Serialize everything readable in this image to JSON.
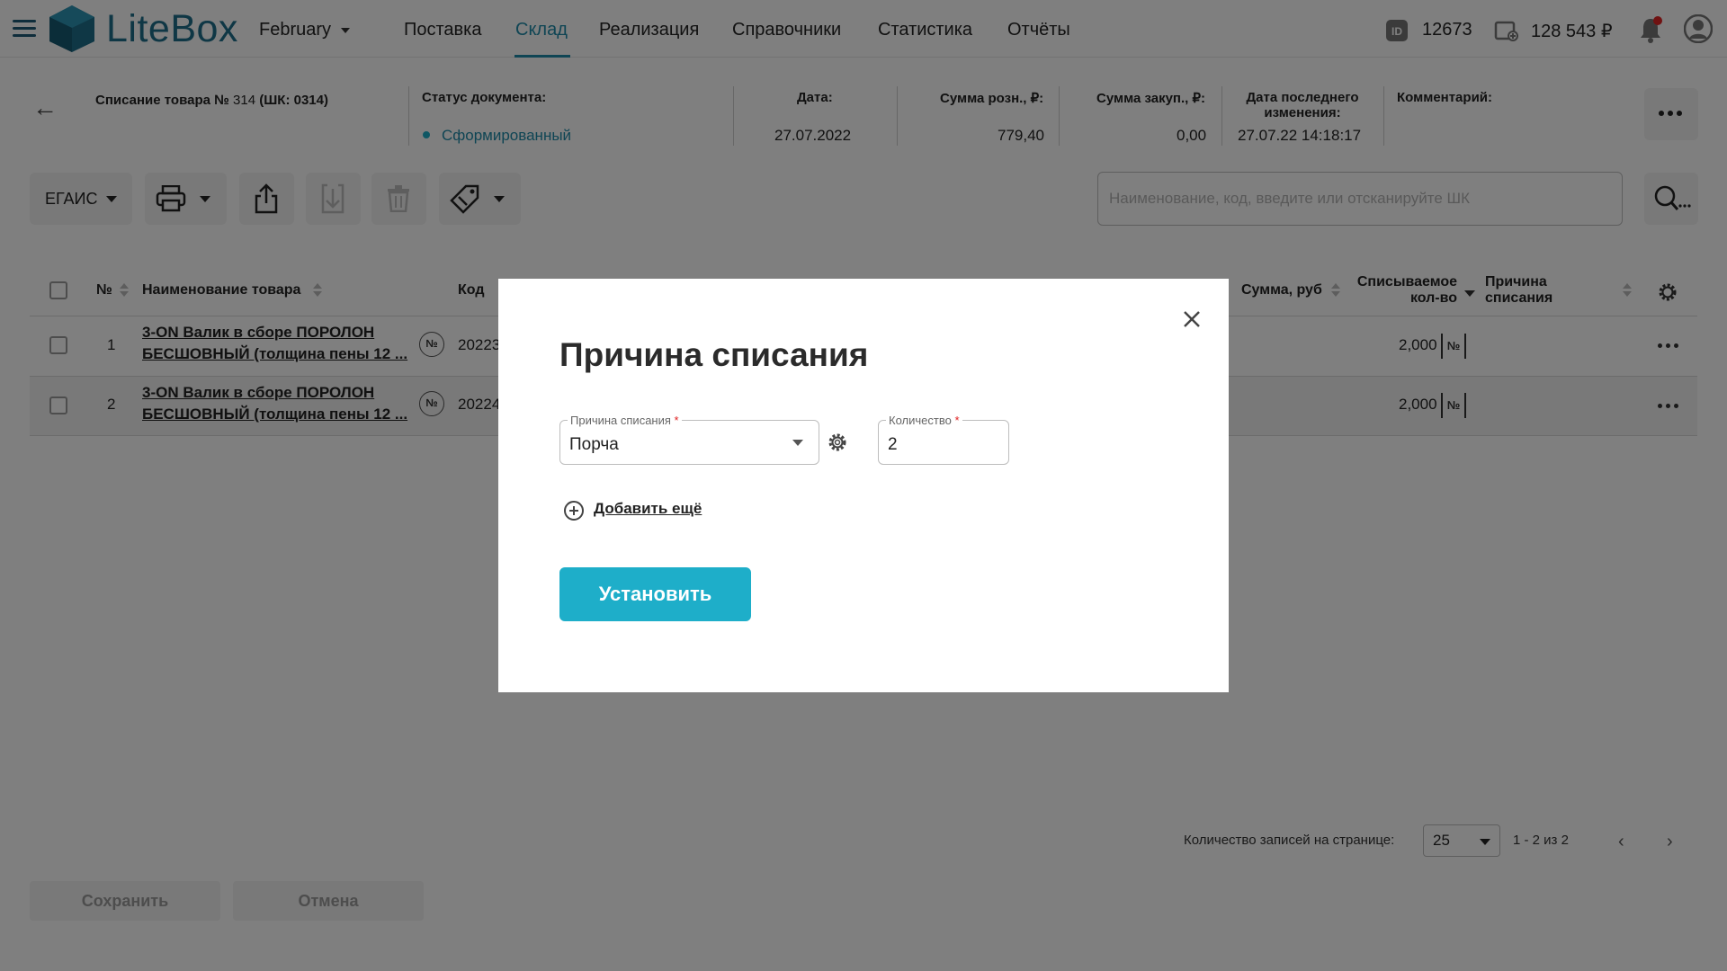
{
  "app": {
    "logo_text": "LiteBox",
    "store": "February",
    "id_value": "12673",
    "balance": "128 543 ₽"
  },
  "nav": [
    "Поставка",
    "Склад",
    "Реализация",
    "Справочники",
    "Статистика",
    "Отчёты"
  ],
  "nav_active": "Склад",
  "document": {
    "title_prefix": "Списание товара №",
    "title_num": "314",
    "title_suffix": "(ШК: 0314)",
    "status_label": "Статус документа:",
    "status_value": "Сформированный",
    "date_label": "Дата:",
    "date_value": "27.07.2022",
    "retail_label": "Сумма розн., ₽:",
    "retail_value": "779,40",
    "purchase_label": "Сумма закуп., ₽:",
    "purchase_value": "0,00",
    "changed_label_1": "Дата последнего",
    "changed_label_2": "изменения:",
    "changed_value": "27.07.22 14:18:17",
    "comment_label": "Комментарий:"
  },
  "toolbar": {
    "egais_label": "ЕГАИС",
    "search_placeholder": "Наименование, код, введите или отсканируйте ШК"
  },
  "table": {
    "headers": {
      "num": "№",
      "name": "Наименование товара",
      "code": "Код",
      "sum": "Сумма, руб",
      "qty_1": "Списываемое",
      "qty_2": "кол-во",
      "reason_1": "Причина",
      "reason_2": "списания"
    },
    "rows": [
      {
        "num": "1",
        "name_1": "3-ON Валик в сборе ПОРОЛОН",
        "name_2": "БЕСШОВНЫЙ (толщина пены 12 ...",
        "badge": "№",
        "code": "20223",
        "qty": "2,000"
      },
      {
        "num": "2",
        "name_1": "3-ON Валик в сборе ПОРОЛОН",
        "name_2": "БЕСШОВНЫЙ (толщина пены 12 ...",
        "badge": "№",
        "code": "20224",
        "qty": "2,000"
      }
    ]
  },
  "pager": {
    "label": "Количество записей на странице:",
    "per_page": "25",
    "range": "1 - 2 из 2"
  },
  "footer": {
    "save": "Сохранить",
    "cancel": "Отмена"
  },
  "modal": {
    "title": "Причина списания",
    "reason_label": "Причина списания",
    "reason_value": "Порча",
    "qty_label": "Количество",
    "qty_value": "2",
    "required_mark": "*",
    "add_more": "Добавить ещё",
    "submit": "Установить"
  },
  "colors": {
    "accent": "#1eaec9",
    "brand": "#1f6f8b",
    "nav_active": "#1e8aa8",
    "notification": "#e02424"
  }
}
